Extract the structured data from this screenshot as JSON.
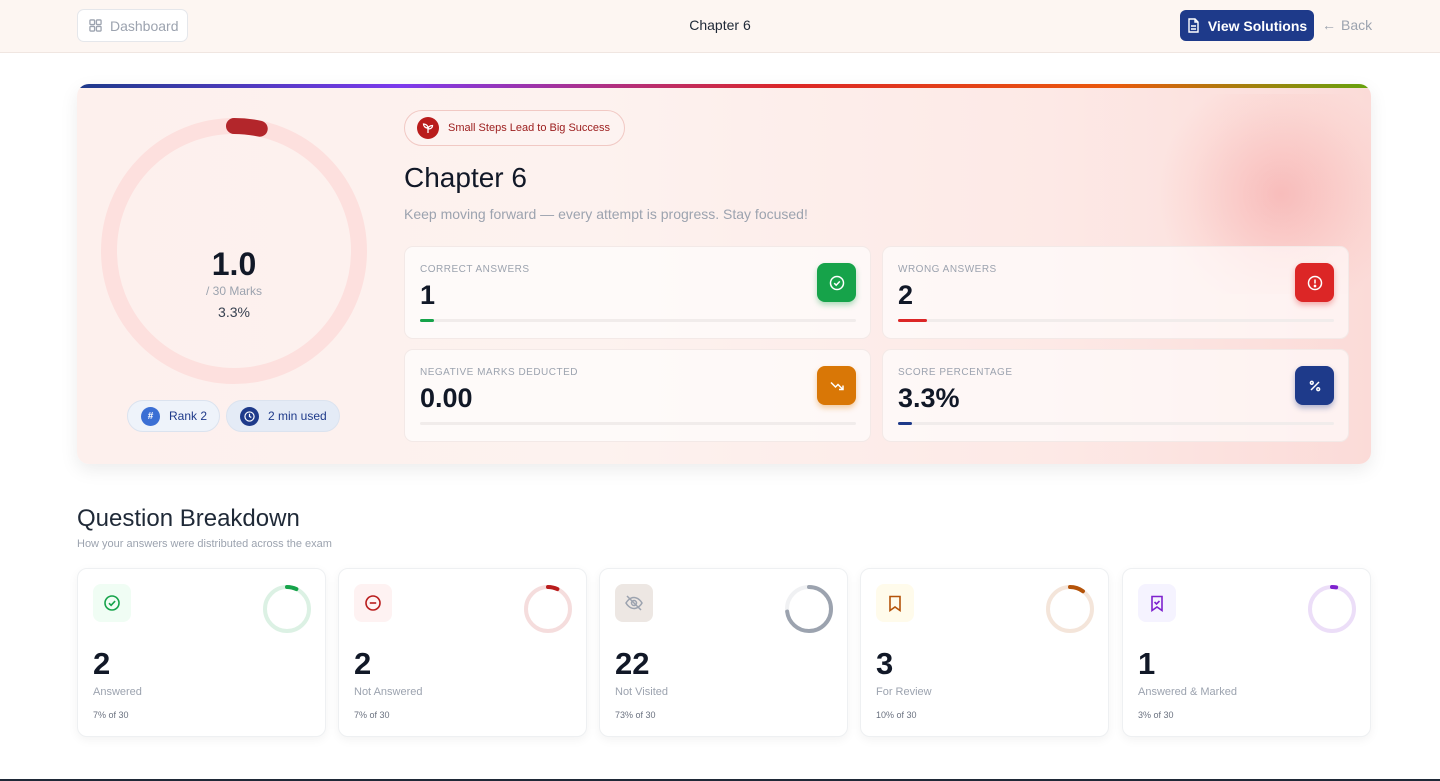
{
  "header": {
    "dashboard_label": "Dashboard",
    "title": "Chapter 6",
    "view_solutions_label": "View Solutions",
    "back_label": "Back"
  },
  "hero": {
    "score": "1.0",
    "marks": "/ 30 Marks",
    "percent": "3.3%",
    "score_fraction": 0.033,
    "rank_label": "Rank 2",
    "time_label": "2 min used",
    "motto": "Small Steps Lead to Big Success",
    "title": "Chapter 6",
    "subtitle": "Keep moving forward — every attempt is progress. Stay focused!",
    "stats": [
      {
        "label": "CORRECT ANSWERS",
        "value": "1",
        "icon": "check-circle-icon",
        "color": "#16a34a",
        "progress": 0.033
      },
      {
        "label": "WRONG ANSWERS",
        "value": "2",
        "icon": "alert-circle-icon",
        "color": "#dc2626",
        "progress": 0.067
      },
      {
        "label": "NEGATIVE MARKS DEDUCTED",
        "value": "0.00",
        "icon": "trending-down-icon",
        "color": "#d97706",
        "progress": 0
      },
      {
        "label": "SCORE PERCENTAGE",
        "value": "3.3%",
        "icon": "percent-icon",
        "color": "#1e3a8a",
        "progress": 0.033
      }
    ]
  },
  "breakdown": {
    "title": "Question Breakdown",
    "subtitle": "How your answers were distributed across the exam",
    "cards": [
      {
        "count": "2",
        "label": "Answered",
        "of": "7% of 30",
        "fraction": 0.07,
        "icon": "check-circle-icon",
        "color": "#16a34a"
      },
      {
        "count": "2",
        "label": "Not Answered",
        "of": "7% of 30",
        "fraction": 0.07,
        "icon": "minus-circle-icon",
        "color": "#b91c1c"
      },
      {
        "count": "22",
        "label": "Not Visited",
        "of": "73% of 30",
        "fraction": 0.73,
        "icon": "eye-off-icon",
        "color": "#9ca3af"
      },
      {
        "count": "3",
        "label": "For Review",
        "of": "10% of 30",
        "fraction": 0.1,
        "icon": "bookmark-icon",
        "color": "#b45309"
      },
      {
        "count": "1",
        "label": "Answered & Marked",
        "of": "3% of 30",
        "fraction": 0.03,
        "icon": "bookmark-check-icon",
        "color": "#7e22ce"
      }
    ]
  }
}
